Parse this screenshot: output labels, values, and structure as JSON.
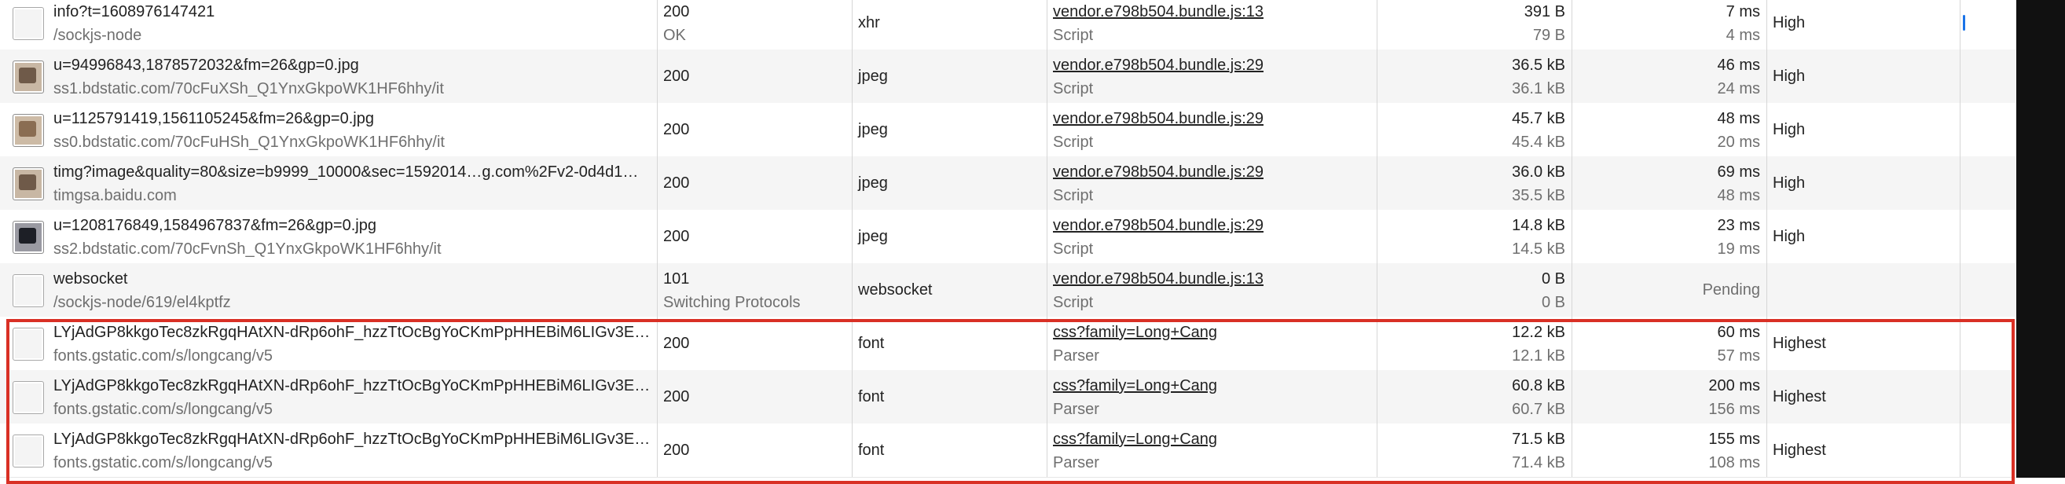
{
  "colors": {
    "highlight_border": "#d93025",
    "row_alt": "#f5f5f5",
    "waterfall_green": "#3cb46e",
    "waterfall_blue": "#1a73e8",
    "waterfall_gray": "#9e9e9e"
  },
  "rows": [
    {
      "icon": "document-icon",
      "name": "info?t=1608976147421",
      "path": "/sockjs-node",
      "status": "200",
      "status_text": "OK",
      "type": "xhr",
      "initiator": "vendor.e798b504.bundle.js:13",
      "initiator_type": "Script",
      "size": "391 B",
      "size_resource": "79 B",
      "time": "7 ms",
      "latency": "4 ms",
      "priority": "High"
    },
    {
      "icon": "image-thumbnail-icon",
      "name": "u=94996843,1878572032&fm=26&gp=0.jpg",
      "path": "ss1.bdstatic.com/70cFuXSh_Q1YnxGkpoWK1HF6hhy/it",
      "status": "200",
      "status_text": "",
      "type": "jpeg",
      "initiator": "vendor.e798b504.bundle.js:29",
      "initiator_type": "Script",
      "size": "36.5 kB",
      "size_resource": "36.1 kB",
      "time": "46 ms",
      "latency": "24 ms",
      "priority": "High"
    },
    {
      "icon": "image-thumbnail-icon",
      "name": "u=1125791419,1561105245&fm=26&gp=0.jpg",
      "path": "ss0.bdstatic.com/70cFuHSh_Q1YnxGkpoWK1HF6hhy/it",
      "status": "200",
      "status_text": "",
      "type": "jpeg",
      "initiator": "vendor.e798b504.bundle.js:29",
      "initiator_type": "Script",
      "size": "45.7 kB",
      "size_resource": "45.4 kB",
      "time": "48 ms",
      "latency": "20 ms",
      "priority": "High"
    },
    {
      "icon": "image-thumbnail-icon",
      "name": "timg?image&quality=80&size=b9999_10000&sec=1592014…g.com%2Fv2-0d4d1…",
      "path": "timgsa.baidu.com",
      "status": "200",
      "status_text": "",
      "type": "jpeg",
      "initiator": "vendor.e798b504.bundle.js:29",
      "initiator_type": "Script",
      "size": "36.0 kB",
      "size_resource": "35.5 kB",
      "time": "69 ms",
      "latency": "48 ms",
      "priority": "High"
    },
    {
      "icon": "image-thumbnail-icon",
      "name": "u=1208176849,1584967837&fm=26&gp=0.jpg",
      "path": "ss2.bdstatic.com/70cFvnSh_Q1YnxGkpoWK1HF6hhy/it",
      "status": "200",
      "status_text": "",
      "type": "jpeg",
      "initiator": "vendor.e798b504.bundle.js:29",
      "initiator_type": "Script",
      "size": "14.8 kB",
      "size_resource": "14.5 kB",
      "time": "23 ms",
      "latency": "19 ms",
      "priority": "High"
    },
    {
      "icon": "document-icon",
      "name": "websocket",
      "path": "/sockjs-node/619/el4kptfz",
      "status": "101",
      "status_text": "Switching Protocols",
      "type": "websocket",
      "initiator": "vendor.e798b504.bundle.js:13",
      "initiator_type": "Script",
      "size": "0 B",
      "size_resource": "0 B",
      "time": "Pending",
      "latency": "",
      "priority": ""
    },
    {
      "icon": "document-icon",
      "name": "LYjAdGP8kkgoTec8zkRgqHAtXN-dRp6ohF_hzzTtOcBgYoCKmPpHHEBiM6LIGv3E…",
      "path": "fonts.gstatic.com/s/longcang/v5",
      "status": "200",
      "status_text": "",
      "type": "font",
      "initiator": "css?family=Long+Cang",
      "initiator_type": "Parser",
      "size": "12.2 kB",
      "size_resource": "12.1 kB",
      "time": "60 ms",
      "latency": "57 ms",
      "priority": "Highest"
    },
    {
      "icon": "document-icon",
      "name": "LYjAdGP8kkgoTec8zkRgqHAtXN-dRp6ohF_hzzTtOcBgYoCKmPpHHEBiM6LIGv3E…",
      "path": "fonts.gstatic.com/s/longcang/v5",
      "status": "200",
      "status_text": "",
      "type": "font",
      "initiator": "css?family=Long+Cang",
      "initiator_type": "Parser",
      "size": "60.8 kB",
      "size_resource": "60.7 kB",
      "time": "200 ms",
      "latency": "156 ms",
      "priority": "Highest"
    },
    {
      "icon": "document-icon",
      "name": "LYjAdGP8kkgoTec8zkRgqHAtXN-dRp6ohF_hzzTtOcBgYoCKmPpHHEBiM6LIGv3E…",
      "path": "fonts.gstatic.com/s/longcang/v5",
      "status": "200",
      "status_text": "",
      "type": "font",
      "initiator": "css?family=Long+Cang",
      "initiator_type": "Parser",
      "size": "71.5 kB",
      "size_resource": "71.4 kB",
      "time": "155 ms",
      "latency": "108 ms",
      "priority": "Highest"
    }
  ]
}
